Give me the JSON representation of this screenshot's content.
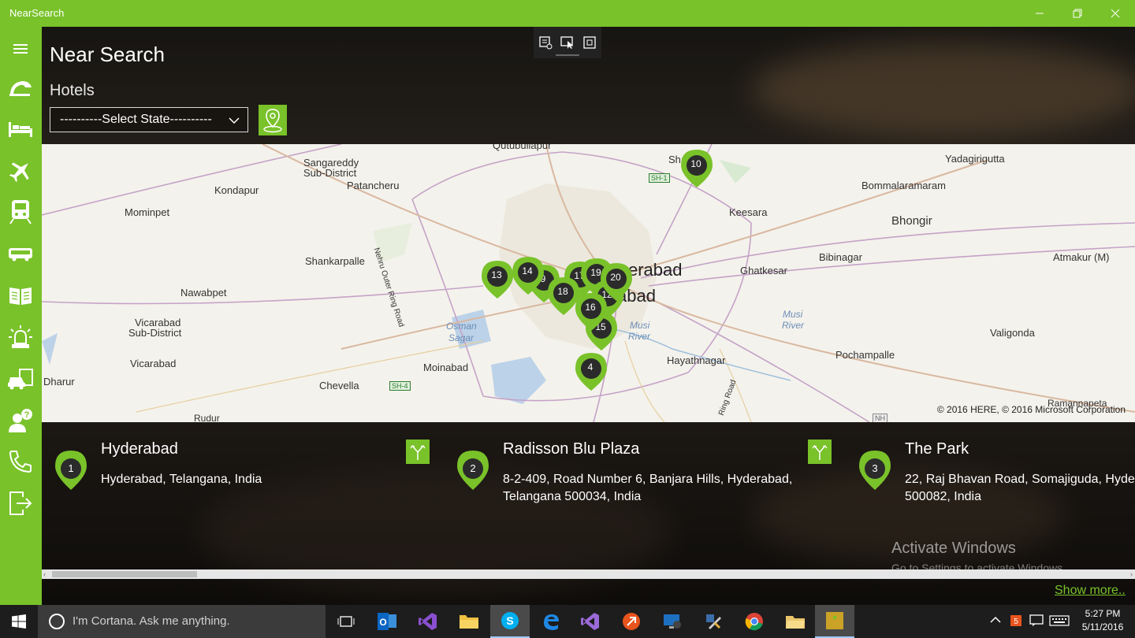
{
  "window": {
    "title": "NearSearch"
  },
  "sidebar": {
    "items": [
      {
        "name": "menu-icon"
      },
      {
        "name": "restaurant-icon"
      },
      {
        "name": "hotel-bed-icon"
      },
      {
        "name": "airplane-icon"
      },
      {
        "name": "train-icon"
      },
      {
        "name": "bus-icon"
      },
      {
        "name": "library-book-icon"
      },
      {
        "name": "emergency-siren-icon"
      },
      {
        "name": "car-service-icon"
      },
      {
        "name": "help-person-icon"
      },
      {
        "name": "phone-icon"
      },
      {
        "name": "logout-icon"
      }
    ]
  },
  "header": {
    "app_title": "Near Search",
    "category": "Hotels",
    "state_select": {
      "value": "----------Select State----------"
    }
  },
  "map": {
    "labels": {
      "qutubullapur": "Qutubullapur",
      "sangareddy": "Sangareddy",
      "sangareddy2": "Sub-District",
      "patancheru": "Patancheru",
      "kondapur": "Kondapur",
      "mominpet": "Mominpet",
      "shankarpalle": "Shankarpalle",
      "nawabpet": "Nawabpet",
      "vicarabad_sub": "Vicarabad",
      "vicarabad_sub2": "Sub-District",
      "vicarabad": "Vicarabad",
      "dharur": "Dharur",
      "chevella": "Chevella",
      "moinabad": "Moinabad",
      "shamirpet": "Shamir",
      "yadagirigutta": "Yadagirigutta",
      "bommalaramaram": "Bommalaramaram",
      "keesara": "Keesara",
      "bhongir": "Bhongir",
      "ghatkesar": "Ghatkesar",
      "bibinagar": "Bibinagar",
      "atmakur": "Atmakur (M)",
      "hyderabad1": "erabad",
      "hyderabad2": "abad",
      "hayathnagar": "Hayathnagar",
      "pochampalle": "Pochampalle",
      "valigonda": "Valigonda",
      "ramannapeta": "Ramannapeta",
      "osman": "Osman",
      "sagar": "Sagar",
      "musi": "Musi",
      "river": "River",
      "musi2": "Musi",
      "river2": "River",
      "orr": "Nehru Outer Ring Road",
      "ringroad": "Ring Road",
      "rudur": "Rudur",
      "sh1": "SH-1",
      "sh4": "SH-4",
      "nh": "NH"
    },
    "copyright": "© 2016 HERE, © 2016 Microsoft Corporation",
    "pins": [
      "10",
      "13",
      "14",
      "9",
      "18",
      "17",
      "19",
      "20",
      "12",
      "16",
      "15",
      "4"
    ]
  },
  "results": [
    {
      "num": "1",
      "name": "Hyderabad",
      "address": "Hyderabad, Telangana, India"
    },
    {
      "num": "2",
      "name": "Radisson Blu Plaza",
      "address": "8-2-409, Road Number 6, Banjara Hills, Hyderabad, Telangana 500034, India"
    },
    {
      "num": "3",
      "name": "The Park",
      "address": "22, Raj Bhavan Road, Somajiguda, Hyde 500082, India"
    }
  ],
  "watermark": {
    "line1": "Activate Windows",
    "line2": "Go to Settings to activate Windows."
  },
  "show_more": "Show more..",
  "taskbar": {
    "cortana_placeholder": "I'm Cortana. Ask me anything.",
    "time": "5:27 PM",
    "date": "5/11/2016"
  },
  "colors": {
    "accent": "#79c22a",
    "pin_dark": "#2b2b2b"
  }
}
